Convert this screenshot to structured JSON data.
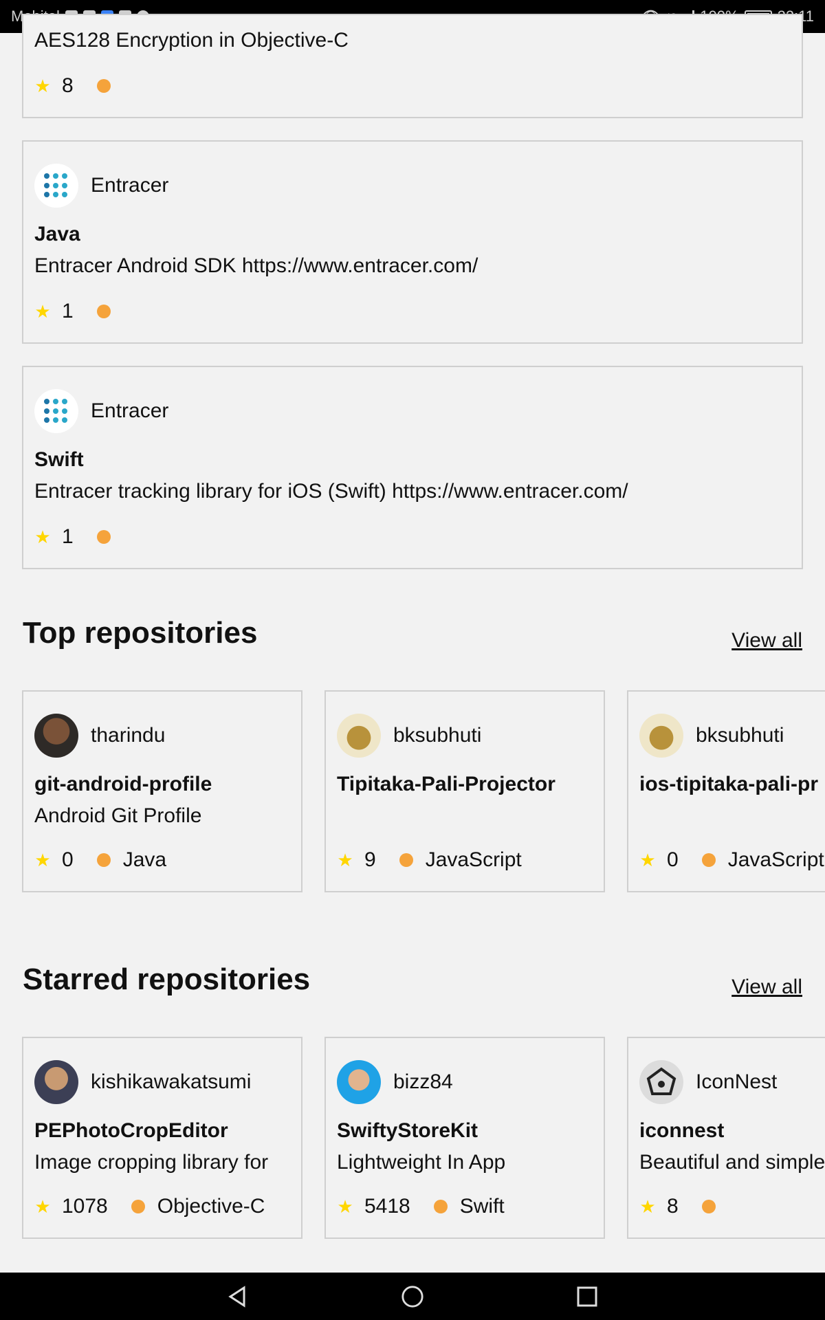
{
  "status_bar": {
    "carrier": "Mobitel",
    "network": "4G",
    "battery": "100%",
    "time": "22:11"
  },
  "top_cards": [
    {
      "description": "AES128 Encryption in Objective-C",
      "stars": "8"
    },
    {
      "owner": "Entracer",
      "name": "Java",
      "description": "Entracer Android SDK https://www.entracer.com/",
      "stars": "1"
    },
    {
      "owner": "Entracer",
      "name": "Swift",
      "description": "Entracer tracking library for iOS (Swift) https://www.entracer.com/",
      "stars": "1"
    }
  ],
  "top_repositories": {
    "title": "Top repositories",
    "view_all": "View all",
    "items": [
      {
        "owner": "tharindu",
        "name": "git-android-profile",
        "description": "Android Git Profile",
        "stars": "0",
        "language": "Java"
      },
      {
        "owner": "bksubhuti",
        "name": "Tipitaka-Pali-Projector",
        "description": "",
        "stars": "9",
        "language": "JavaScript"
      },
      {
        "owner": "bksubhuti",
        "name": "ios-tipitaka-pali-pr",
        "description": "",
        "stars": "0",
        "language": "JavaScript"
      }
    ]
  },
  "starred_repositories": {
    "title": "Starred repositories",
    "view_all": "View all",
    "items": [
      {
        "owner": "kishikawakatsumi",
        "name": "PEPhotoCropEditor",
        "description": "Image cropping library for",
        "stars": "1078",
        "language": "Objective-C"
      },
      {
        "owner": "bizz84",
        "name": "SwiftyStoreKit",
        "description": "Lightweight In App",
        "stars": "5418",
        "language": "Swift"
      },
      {
        "owner": "IconNest",
        "name": "iconnest",
        "description": "Beautiful and simple",
        "stars": "8",
        "language": ""
      }
    ]
  },
  "colors": {
    "language_dot": "#f5a33b",
    "star": "#ffd600",
    "background": "#f2f2f2",
    "border": "#cfcfcf"
  }
}
